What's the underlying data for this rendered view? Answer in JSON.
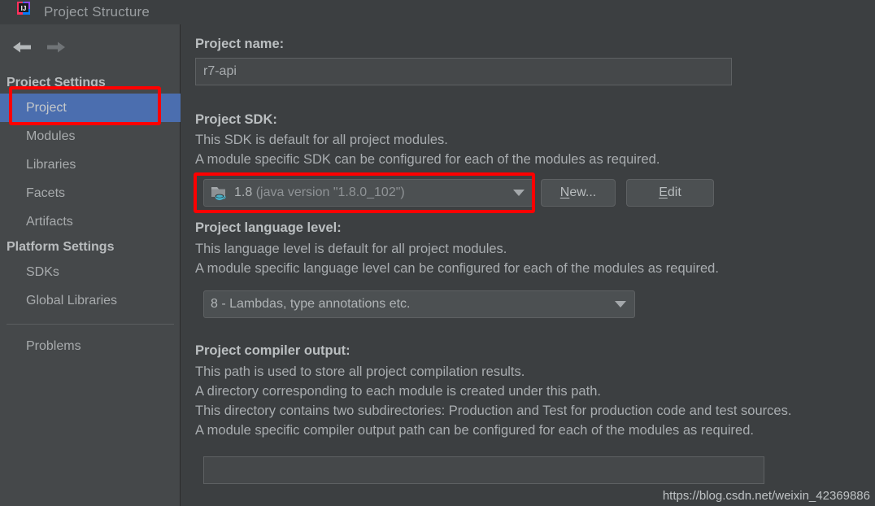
{
  "window": {
    "title": "Project Structure",
    "logo_icon": "intellij-idea-logo"
  },
  "nav": {
    "back_icon": "arrow-left-icon",
    "forward_icon": "arrow-right-icon"
  },
  "sidebar": {
    "groups": [
      {
        "title": "Project Settings",
        "items": [
          {
            "label": "Project",
            "selected": true
          },
          {
            "label": "Modules",
            "selected": false
          },
          {
            "label": "Libraries",
            "selected": false
          },
          {
            "label": "Facets",
            "selected": false
          },
          {
            "label": "Artifacts",
            "selected": false
          }
        ]
      },
      {
        "title": "Platform Settings",
        "items": [
          {
            "label": "SDKs",
            "selected": false
          },
          {
            "label": "Global Libraries",
            "selected": false
          }
        ]
      }
    ],
    "standalone_item": {
      "label": "Problems",
      "selected": false
    }
  },
  "main": {
    "project_name": {
      "label": "Project name:",
      "value": "r7-api"
    },
    "project_sdk": {
      "label": "Project SDK:",
      "description_line1": "This SDK is default for all project modules.",
      "description_line2": "A module specific SDK can be configured for each of the modules as required.",
      "selected_version": "1.8",
      "selected_detail": "(java version \"1.8.0_102\")",
      "icon": "java-sdk-folder-icon",
      "dropdown_icon": "chevron-down-icon",
      "new_button": {
        "prefix": "",
        "mnemonic": "N",
        "suffix": "ew..."
      },
      "edit_button": {
        "prefix": "",
        "mnemonic": "E",
        "suffix": "dit"
      }
    },
    "language_level": {
      "label": "Project language level:",
      "description_line1": "This language level is default for all project modules.",
      "description_line2": "A module specific language level can be configured for each of the modules as required.",
      "selected": "8 - Lambdas, type annotations etc.",
      "dropdown_icon": "chevron-down-icon"
    },
    "compiler_output": {
      "label": "Project compiler output:",
      "description_line1": "This path is used to store all project compilation results.",
      "description_line2": "A directory corresponding to each module is created under this path.",
      "description_line3": "This directory contains two subdirectories: Production and Test for production code and test sources.",
      "description_line4": "A module specific compiler output path can be configured for each of the modules as required.",
      "value": ""
    }
  },
  "watermark": {
    "text": "https://blog.csdn.net/weixin_42369886"
  },
  "colors": {
    "background": "#3c3f41",
    "sidebar": "#45484a",
    "selection": "#4b6eaf",
    "annotation": "#fe0000",
    "text": "#a9adb0",
    "text_bold": "#bbbfc1",
    "java_icon": "#48b0c8"
  }
}
